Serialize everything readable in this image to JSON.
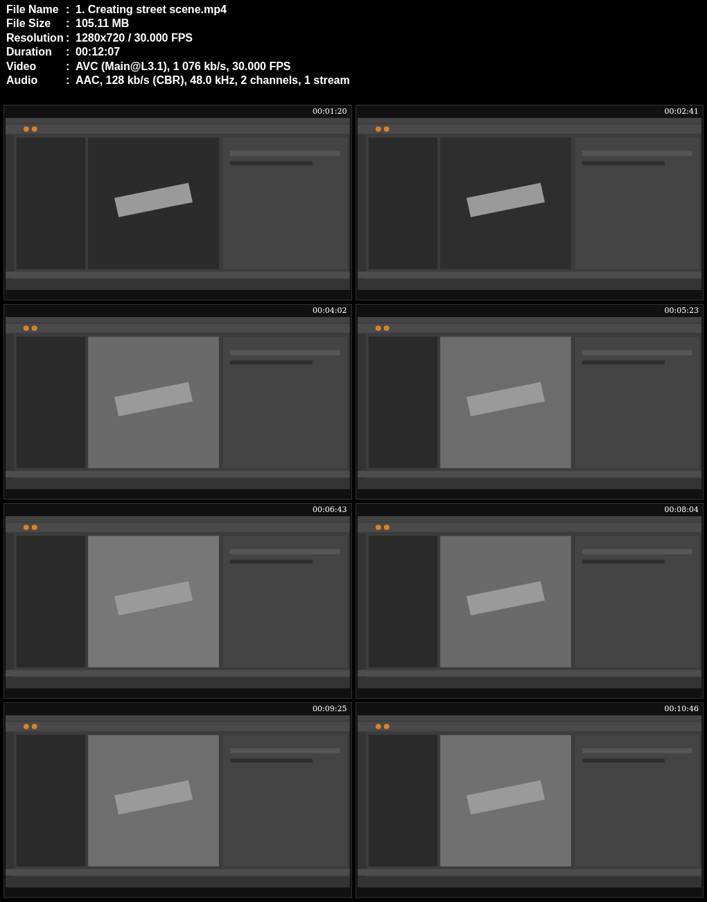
{
  "info": [
    {
      "label": "File Name",
      "separator": ":",
      "value": "1. Creating street scene.mp4"
    },
    {
      "label": "File Size",
      "separator": ":",
      "value": "105.11 MB"
    },
    {
      "label": "Resolution",
      "separator": ":",
      "value": "1280x720 / 30.000 FPS"
    },
    {
      "label": "Duration",
      "separator": ":",
      "value": "00:12:07"
    },
    {
      "label": "Video",
      "separator": ":",
      "value": "AVC (Main@L3.1), 1 076 kb/s, 30.000 FPS"
    },
    {
      "label": "Audio",
      "separator": ":",
      "value": "AAC, 128 kb/s (CBR), 48.0 kHz, 2 channels, 1 stream"
    }
  ],
  "frames": [
    {
      "timestamp": "00:01:20",
      "kind": "picture"
    },
    {
      "timestamp": "00:02:41",
      "kind": "picture"
    },
    {
      "timestamp": "00:04:02",
      "kind": "picture"
    },
    {
      "timestamp": "00:05:23",
      "kind": "picture"
    },
    {
      "timestamp": "00:06:43",
      "kind": "picture"
    },
    {
      "timestamp": "00:08:04",
      "kind": "picture"
    },
    {
      "timestamp": "00:09:25",
      "kind": "picture"
    },
    {
      "timestamp": "00:10:46",
      "kind": "picture"
    }
  ]
}
